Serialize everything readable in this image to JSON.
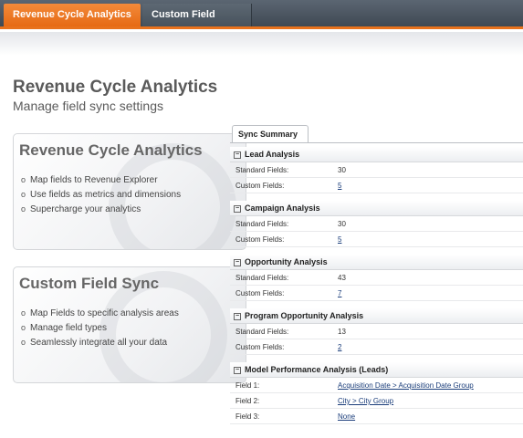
{
  "tabs": [
    "Revenue Cycle Analytics",
    "Custom Field Sync"
  ],
  "page": {
    "title": "Revenue Cycle Analytics",
    "subtitle": "Manage field sync settings"
  },
  "cards": [
    {
      "title": "Revenue Cycle Analytics",
      "items": [
        "Map fields to Revenue Explorer",
        "Use fields as metrics and dimensions",
        "Supercharge your analytics"
      ]
    },
    {
      "title": "Custom Field Sync",
      "items": [
        "Map Fields to specific analysis areas",
        "Manage field types",
        "Seamlessly integrate all your data"
      ]
    }
  ],
  "summary": {
    "tab_label": "Sync Summary",
    "sections": [
      {
        "title": "Lead Analysis",
        "rows": [
          {
            "label": "Standard Fields:",
            "value": "30",
            "link": false
          },
          {
            "label": "Custom Fields:",
            "value": "5",
            "link": true
          }
        ]
      },
      {
        "title": "Campaign Analysis",
        "rows": [
          {
            "label": "Standard Fields:",
            "value": "30",
            "link": false
          },
          {
            "label": "Custom Fields:",
            "value": "5",
            "link": true
          }
        ]
      },
      {
        "title": "Opportunity Analysis",
        "rows": [
          {
            "label": "Standard Fields:",
            "value": "43",
            "link": false
          },
          {
            "label": "Custom Fields:",
            "value": "7",
            "link": true
          }
        ]
      },
      {
        "title": "Program Opportunity Analysis",
        "rows": [
          {
            "label": "Standard Fields:",
            "value": "13",
            "link": false
          },
          {
            "label": "Custom Fields:",
            "value": "2",
            "link": true
          }
        ]
      },
      {
        "title": "Model Performance Analysis (Leads)",
        "rows": [
          {
            "label": "Field 1:",
            "value": "Acquisition Date > Acquisition Date Group",
            "link": true
          },
          {
            "label": "Field 2:",
            "value": "City > City Group",
            "link": true
          },
          {
            "label": "Field 3:",
            "value": "None",
            "link": true
          }
        ]
      }
    ]
  }
}
